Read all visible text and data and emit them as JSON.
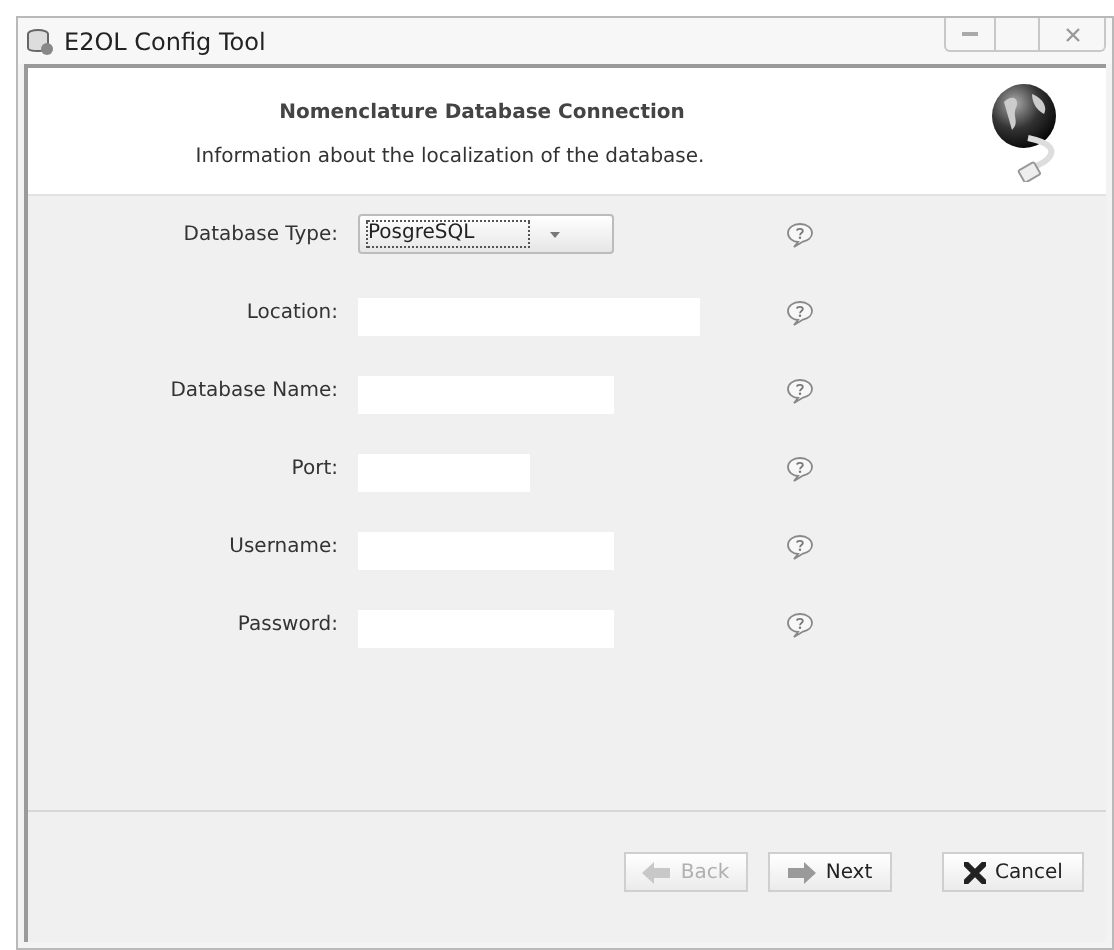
{
  "window": {
    "title": "E2OL Config Tool"
  },
  "header": {
    "title": "Nomenclature Database Connection",
    "subtitle": "Information about the localization of the database."
  },
  "fields": [
    {
      "kind": "dropdown",
      "label": "Database Type:",
      "value": "PosgreSQL"
    },
    {
      "kind": "text",
      "label": "Location:"
    },
    {
      "kind": "text",
      "label": "Database Name:"
    },
    {
      "kind": "text",
      "label": "Port:"
    },
    {
      "kind": "text",
      "label": "Username:"
    },
    {
      "kind": "text",
      "label": "Password:"
    }
  ],
  "buttons": [
    {
      "kind": "back",
      "label": "Back",
      "disabled": true
    },
    {
      "kind": "next",
      "label": "Next",
      "disabled": false
    },
    {
      "kind": "cancel",
      "label": "Cancel",
      "disabled": false
    }
  ]
}
